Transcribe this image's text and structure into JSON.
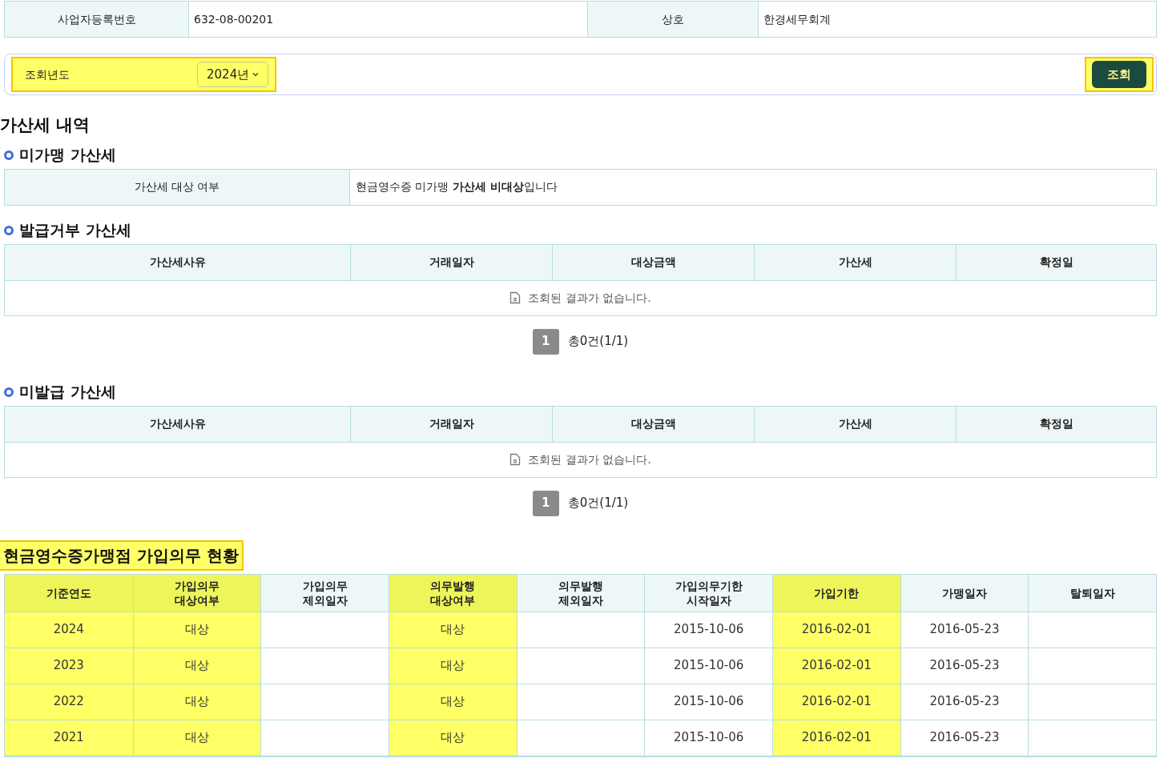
{
  "business_info": [
    {
      "label": "사업자등록번호",
      "value": "632-08-00201"
    },
    {
      "label": "상호",
      "value": "한경세무회계"
    }
  ],
  "filter": {
    "label": "조회년도",
    "year_select": "2024년",
    "highlighted": true
  },
  "search_button": {
    "label": "조회",
    "highlighted": true
  },
  "page_title": "가산세 내역",
  "sections": [
    {
      "kind": "info",
      "title": "미가맹 가산세",
      "label": "가산세 대상 여부",
      "value": "현금영수증 미가맹 **가산세 비대상**입니다"
    },
    {
      "kind": "table",
      "title": "발급거부 가산세",
      "columns": [
        "가산세사유",
        "거래일자",
        "대상금액",
        "가산세",
        "확정일"
      ],
      "empty_message": "조회된 결과가 없습니다.",
      "pagination": {
        "page": "1",
        "summary": "총0건(1/1)"
      }
    },
    {
      "kind": "table",
      "title": "미발급 가산세",
      "columns": [
        "가산세사유",
        "거래일자",
        "대상금액",
        "가산세",
        "확정일"
      ],
      "empty_message": "조회된 결과가 없습니다.",
      "pagination": {
        "page": "1",
        "summary": "총0건(1/1)"
      }
    }
  ],
  "membership": {
    "title": "현금영수증가맹점 가입의무 현황",
    "highlighted": true,
    "columns": [
      {
        "label": "기준연도",
        "highlighted": true
      },
      {
        "label": "가입의무\n대상여부",
        "highlighted": true
      },
      {
        "label": "가입의무\n제외일자",
        "highlighted": false
      },
      {
        "label": "의무발행\n대상여부",
        "highlighted": true
      },
      {
        "label": "의무발행\n제외일자",
        "highlighted": false
      },
      {
        "label": "가입의무기한\n시작일자",
        "highlighted": false
      },
      {
        "label": "가입기한",
        "highlighted": true
      },
      {
        "label": "가맹일자",
        "highlighted": false
      },
      {
        "label": "탈퇴일자",
        "highlighted": false
      }
    ],
    "rows": [
      [
        "2024",
        "대상",
        "",
        "대상",
        "",
        "2015-10-06",
        "2016-02-01",
        "2016-05-23",
        ""
      ],
      [
        "2023",
        "대상",
        "",
        "대상",
        "",
        "2015-10-06",
        "2016-02-01",
        "2016-05-23",
        ""
      ],
      [
        "2022",
        "대상",
        "",
        "대상",
        "",
        "2015-10-06",
        "2016-02-01",
        "2016-05-23",
        ""
      ],
      [
        "2021",
        "대상",
        "",
        "대상",
        "",
        "2015-10-06",
        "2016-02-01",
        "2016-05-23",
        ""
      ]
    ]
  }
}
